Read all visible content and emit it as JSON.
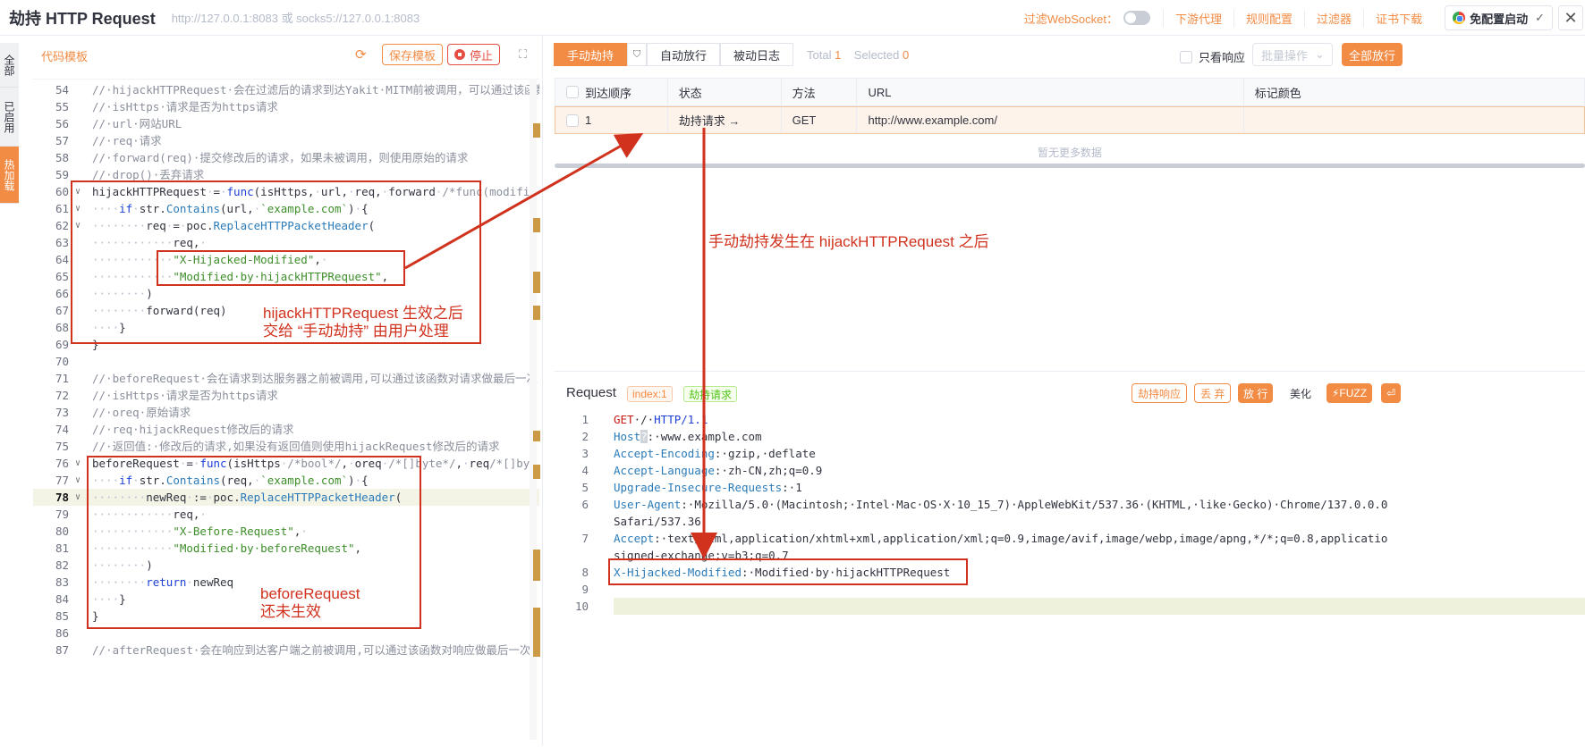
{
  "app": {
    "title": "劫持 HTTP Request",
    "subtitle": "http://127.0.0.1:8083 或 socks5://127.0.0.1:8083"
  },
  "topbar": {
    "ws_label": "过滤WebSocket：",
    "links": [
      "下游代理",
      "规则配置",
      "过滤器",
      "证书下载"
    ],
    "launch_label": "免配置启动"
  },
  "sidetabs": [
    "全部",
    "已启用",
    "热加载"
  ],
  "left": {
    "title": "代码模板",
    "save_label": "保存模板",
    "stop_label": "停止"
  },
  "code_lines": [
    {
      "n": "54",
      "t": "<span class=\"cm\">//·hijackHTTPRequest·会在过滤后的请求到达Yakit·MITM前被调用，可以通过该函数</span>"
    },
    {
      "n": "55",
      "t": "<span class=\"cm\">//·isHttps·请求是否为https请求</span>"
    },
    {
      "n": "56",
      "t": "<span class=\"cm\">//·url·网站URL</span>"
    },
    {
      "n": "57",
      "t": "<span class=\"cm\">//·req·请求</span>"
    },
    {
      "n": "58",
      "t": "<span class=\"cm\">//·forward(req)·提交修改后的请求，如果未被调用，则使用原始的请求</span>"
    },
    {
      "n": "59",
      "t": "<span class=\"cm\">//·drop()·丢弃请求</span>"
    },
    {
      "n": "60",
      "f": true,
      "t": "hijackHTTPRequest<span class=\"ds\">·</span>=<span class=\"ds\">·</span><span class=\"kw\">func</span>(isHttps,<span class=\"ds\">·</span>url,<span class=\"ds\">·</span>req,<span class=\"ds\">·</span>forward<span class=\"ds\">·</span><span class=\"cm\">/*func(modifi</span>"
    },
    {
      "n": "61",
      "f": true,
      "t": "<span class=\"ds\">····</span><span class=\"kw\">if</span><span class=\"ds\">·</span>str.<span class=\"fn\">Contains</span>(url,<span class=\"ds\">·</span><span class=\"str\">`example.com`</span>)<span class=\"ds\">·</span>{"
    },
    {
      "n": "62",
      "f": true,
      "t": "<span class=\"ds\">········</span>req<span class=\"ds\">·</span>=<span class=\"ds\">·</span>poc.<span class=\"fn\">ReplaceHTTPPacketHeader</span>("
    },
    {
      "n": "63",
      "t": "<span class=\"ds\">············</span>req,<span class=\"ds\">·</span>"
    },
    {
      "n": "64",
      "t": "<span class=\"ds\">············</span><span class=\"str\">\"X-Hijacked-Modified\"</span>,<span class=\"ds\">·</span>"
    },
    {
      "n": "65",
      "t": "<span class=\"ds\">············</span><span class=\"str\">\"Modified·by·hijackHTTPRequest\"</span>,"
    },
    {
      "n": "66",
      "t": "<span class=\"ds\">········</span>)"
    },
    {
      "n": "67",
      "t": "<span class=\"ds\">········</span>forward(req)"
    },
    {
      "n": "68",
      "t": "<span class=\"ds\">····</span>}"
    },
    {
      "n": "69",
      "t": "}"
    },
    {
      "n": "70",
      "t": ""
    },
    {
      "n": "71",
      "t": "<span class=\"cm\">//·beforeRequest·会在请求到达服务器之前被调用,可以通过该函数对请求做最后一次</span>"
    },
    {
      "n": "72",
      "t": "<span class=\"cm\">//·isHttps·请求是否为https请求</span>"
    },
    {
      "n": "73",
      "t": "<span class=\"cm\">//·oreq·原始请求</span>"
    },
    {
      "n": "74",
      "t": "<span class=\"cm\">//·req·hijackRequest修改后的请求</span>"
    },
    {
      "n": "75",
      "t": "<span class=\"cm\">//·返回值:·修改后的请求,如果没有返回值则使用hijackRequest修改后的请求</span>"
    },
    {
      "n": "76",
      "f": true,
      "t": "beforeRequest<span class=\"ds\">·</span>=<span class=\"ds\">·</span><span class=\"kw\">func</span>(isHttps<span class=\"ds\">·</span><span class=\"cm\">/*bool*/</span>,<span class=\"ds\">·</span>oreq<span class=\"ds\">·</span><span class=\"cm\">/*[]byte*/</span>,<span class=\"ds\">·</span>req<span class=\"cm\">/*[]by</span>"
    },
    {
      "n": "77",
      "f": true,
      "t": "<span class=\"ds\">····</span><span class=\"kw\">if</span><span class=\"ds\">·</span>str.<span class=\"fn\">Contains</span>(req,<span class=\"ds\">·</span><span class=\"str\">`example.com`</span>)<span class=\"ds\">·</span>{"
    },
    {
      "n": "78",
      "f": true,
      "hl": true,
      "t": "<span class=\"ds\">········</span>newReq<span class=\"ds\">·</span>:=<span class=\"ds\">·</span>poc.<span class=\"fn\">ReplaceHTTPPacketHeader</span>("
    },
    {
      "n": "79",
      "t": "<span class=\"ds\">············</span>req,<span class=\"ds\">·</span>"
    },
    {
      "n": "80",
      "t": "<span class=\"ds\">············</span><span class=\"str\">\"X-Before-Request\"</span>,<span class=\"ds\">·</span>"
    },
    {
      "n": "81",
      "t": "<span class=\"ds\">············</span><span class=\"str\">\"Modified·by·beforeRequest\"</span>,"
    },
    {
      "n": "82",
      "t": "<span class=\"ds\">········</span>)"
    },
    {
      "n": "83",
      "t": "<span class=\"ds\">········</span><span class=\"kw\">return</span><span class=\"ds\">·</span>newReq"
    },
    {
      "n": "84",
      "t": "<span class=\"ds\">····</span>}"
    },
    {
      "n": "85",
      "t": "}"
    },
    {
      "n": "86",
      "t": ""
    },
    {
      "n": "87",
      "t": "<span class=\"cm\">//·afterRequest·会在响应到达客户端之前被调用,可以通过该函数对响应做最后一次</span>"
    }
  ],
  "right": {
    "tabs": [
      "手动劫持",
      "自动放行",
      "被动日志"
    ],
    "total_label": "Total",
    "total": "1",
    "selected_label": "Selected",
    "selected": "0",
    "only_resp_label": "只看响应",
    "batch_label": "批量操作",
    "pass_all_label": "全部放行",
    "columns": [
      "到达顺序",
      "状态",
      "方法",
      "URL",
      "标记颜色"
    ],
    "row": {
      "order": "1",
      "status": "劫持请求 →",
      "method": "GET",
      "url": "http://www.example.com/",
      "color": ""
    },
    "no_more": "暂无更多数据"
  },
  "request": {
    "title": "Request",
    "index_tag": "index:1",
    "type_tag": "劫持请求",
    "btn_hijack_resp": "劫持响应",
    "btn_drop": "丢 弃",
    "btn_pass": "放 行",
    "btn_beautify": "美化",
    "btn_fuzz": "⚡FUZZ",
    "lines": [
      {
        "n": "1",
        "t": "<span class=\"hm\">GET</span>·/·<span class=\"hp\">HTTP/1.1</span>"
      },
      {
        "n": "2",
        "t": "<span class=\"hk\">Host</span><span style=\"background:#cfd3da;color:#fff\">?</span>:·www.example.com"
      },
      {
        "n": "3",
        "t": "<span class=\"hk\">Accept-Encoding</span>:·gzip,·deflate"
      },
      {
        "n": "4",
        "t": "<span class=\"hk\">Accept-Language</span>:·zh-CN,zh;q=0.9"
      },
      {
        "n": "5",
        "t": "<span class=\"hk\">Upgrade-Insecure-Requests</span>:·1"
      },
      {
        "n": "6",
        "t": "<span class=\"hk\">User-Agent</span>:·Mozilla/5.0·(Macintosh;·Intel·Mac·OS·X·10_15_7)·AppleWebKit/537.36·(KHTML,·like·Gecko)·Chrome/137.0.0.0"
      },
      {
        "n": "",
        "t": "Safari/537.36"
      },
      {
        "n": "7",
        "t": "<span class=\"hk\">Accept</span>:·text/html,application/xhtml+xml,application/xml;q=0.9,image/avif,image/webp,image/apng,*/*;q=0.8,applicatio"
      },
      {
        "n": "",
        "t": "signed-exchange;v=b3;q=0.7"
      },
      {
        "n": "8",
        "t": "<span class=\"hk\">X-Hijacked-Modified</span>:·Modified·by·hijackHTTPRequest"
      },
      {
        "n": "9",
        "t": ""
      },
      {
        "n": "10",
        "t": ""
      }
    ]
  },
  "annotations": {
    "a1": "hijackHTTPRequest 生效之后\n交给 “手动劫持” 由用户处理",
    "a2": "beforeRequest\n还未生效",
    "a3": "手动劫持发生在 hijackHTTPRequest 之后"
  },
  "colors": {
    "accent": "#f28b44",
    "annotation": "#d0321e"
  }
}
